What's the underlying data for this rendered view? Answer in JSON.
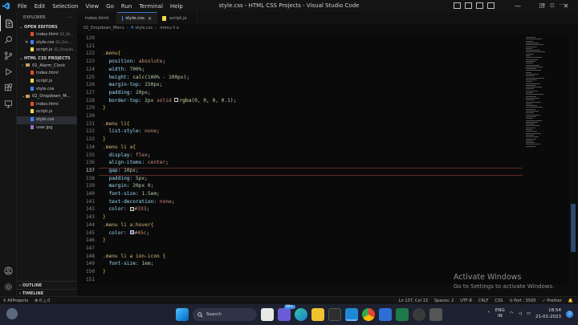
{
  "titlebar": {
    "title": "style.css - HTML CSS Projects - Visual Studio Code",
    "menus": [
      "File",
      "Edit",
      "Selection",
      "View",
      "Go",
      "Run",
      "Terminal",
      "Help"
    ],
    "controls": {
      "minimize": "—",
      "maximize": "☐",
      "close": "✕"
    }
  },
  "sidebar": {
    "header": "EXPLORER",
    "header_more": "···",
    "open_editors_label": "OPEN EDITORS",
    "open_editors": [
      {
        "name": "index.html",
        "desc": "02_Dr...",
        "color": "#e44d26",
        "close": ""
      },
      {
        "name": "style.css",
        "desc": "02_Dro...",
        "color": "#3b82f6",
        "close": "✕"
      },
      {
        "name": "script.js",
        "desc": "02_Dropdo...",
        "color": "#f0db4f",
        "close": ""
      }
    ],
    "project_label": "HTML CSS PROJECTS",
    "tree": [
      {
        "name": "01_Alarm_Clock",
        "type": "folder",
        "depth": 1,
        "arrow": "›",
        "color": "#c5a15a"
      },
      {
        "name": "index.html",
        "type": "file",
        "depth": 2,
        "color": "#e44d26"
      },
      {
        "name": "script.js",
        "type": "file",
        "depth": 2,
        "color": "#f0db4f"
      },
      {
        "name": "style.css",
        "type": "file",
        "depth": 2,
        "color": "#3b82f6"
      },
      {
        "name": "02_Dropdown_M...",
        "type": "folder",
        "depth": 1,
        "arrow": "⌄",
        "color": "#c5a15a"
      },
      {
        "name": "index.html",
        "type": "file",
        "depth": 2,
        "color": "#e44d26"
      },
      {
        "name": "script.js",
        "type": "file",
        "depth": 2,
        "color": "#f0db4f"
      },
      {
        "name": "style.css",
        "type": "file",
        "depth": 2,
        "color": "#3b82f6",
        "active": true
      },
      {
        "name": "user.jpg",
        "type": "file",
        "depth": 2,
        "color": "#a66bd3"
      }
    ],
    "outline_label": "OUTLINE",
    "timeline_label": "TIMELINE"
  },
  "tabs": [
    {
      "label": "index.html",
      "color": "#e44d26",
      "active": false,
      "close": ""
    },
    {
      "label": "style.css",
      "color": "#3b82f6",
      "active": true,
      "close": "✕"
    },
    {
      "label": "script.js",
      "color": "#f0db4f",
      "active": false,
      "close": ""
    }
  ],
  "tab_actions": [
    "⇄",
    "◫",
    "···"
  ],
  "breadcrumb": {
    "folder": "02_Dropdown_Menu",
    "file": "style.css",
    "symbol": ".menu li a",
    "sep": "›"
  },
  "editor": {
    "current_line": 137,
    "lines": [
      {
        "n": 120,
        "t": []
      },
      {
        "n": 121,
        "t": []
      },
      {
        "n": 122,
        "t": [
          [
            "sel",
            ".menu"
          ],
          [
            "brace",
            "{"
          ]
        ]
      },
      {
        "n": 123,
        "t": [
          [
            "prop",
            "  position"
          ],
          [
            "",
            ": "
          ],
          [
            "val",
            "absolute"
          ],
          [
            "",
            ";"
          ]
        ]
      },
      {
        "n": 124,
        "t": [
          [
            "prop",
            "  width"
          ],
          [
            "",
            ": "
          ],
          [
            "num",
            "700%"
          ],
          [
            "",
            ";"
          ]
        ]
      },
      {
        "n": 125,
        "t": [
          [
            "prop",
            "  height"
          ],
          [
            "",
            ": "
          ],
          [
            "fn",
            "calc"
          ],
          [
            "",
            "("
          ],
          [
            "num",
            "100%"
          ],
          [
            "",
            " - "
          ],
          [
            "num",
            "100px"
          ],
          [
            "",
            ");"
          ]
        ]
      },
      {
        "n": 126,
        "t": [
          [
            "prop",
            "  margin-top"
          ],
          [
            "",
            ": "
          ],
          [
            "num",
            "150px"
          ],
          [
            "",
            ";"
          ]
        ]
      },
      {
        "n": 127,
        "t": [
          [
            "prop",
            "  padding"
          ],
          [
            "",
            ": "
          ],
          [
            "num",
            "20px"
          ],
          [
            "",
            ";"
          ]
        ]
      },
      {
        "n": 128,
        "t": [
          [
            "prop",
            "  border-top"
          ],
          [
            "",
            ": "
          ],
          [
            "num",
            "2px"
          ],
          [
            "",
            " "
          ],
          [
            "val",
            "solid"
          ],
          [
            "",
            " "
          ],
          [
            "swatch",
            "#000000"
          ],
          [
            "fn",
            "rgba"
          ],
          [
            "",
            "("
          ],
          [
            "num",
            "0"
          ],
          [
            "",
            ", "
          ],
          [
            "num",
            "0"
          ],
          [
            "",
            ", "
          ],
          [
            "num",
            "0"
          ],
          [
            "",
            ", "
          ],
          [
            "num",
            "0.1"
          ],
          [
            "",
            ");"
          ]
        ]
      },
      {
        "n": 129,
        "t": [
          [
            "brace",
            "}"
          ]
        ]
      },
      {
        "n": 130,
        "t": []
      },
      {
        "n": 131,
        "t": [
          [
            "sel",
            ".menu li"
          ],
          [
            "brace",
            "{"
          ]
        ]
      },
      {
        "n": 132,
        "t": [
          [
            "prop",
            "  list-style"
          ],
          [
            "",
            ": "
          ],
          [
            "val",
            "none"
          ],
          [
            "",
            ";"
          ]
        ]
      },
      {
        "n": 133,
        "t": [
          [
            "brace",
            "}"
          ]
        ]
      },
      {
        "n": 134,
        "t": [
          [
            "sel",
            ".menu li a"
          ],
          [
            "brace",
            "{"
          ]
        ]
      },
      {
        "n": 135,
        "t": [
          [
            "prop",
            "  display"
          ],
          [
            "",
            ": "
          ],
          [
            "val",
            "flex"
          ],
          [
            "",
            ";"
          ]
        ]
      },
      {
        "n": 136,
        "t": [
          [
            "prop",
            "  align-items"
          ],
          [
            "",
            ": "
          ],
          [
            "val",
            "center"
          ],
          [
            "",
            ";"
          ]
        ]
      },
      {
        "n": 137,
        "t": [
          [
            "prop",
            "  gap"
          ],
          [
            "",
            ": "
          ],
          [
            "num",
            "10px"
          ],
          [
            "",
            ";"
          ]
        ]
      },
      {
        "n": 138,
        "t": [
          [
            "prop",
            "  padding"
          ],
          [
            "",
            ": "
          ],
          [
            "num",
            "5px"
          ],
          [
            "",
            ";"
          ]
        ]
      },
      {
        "n": 139,
        "t": [
          [
            "prop",
            "  margin"
          ],
          [
            "",
            ": "
          ],
          [
            "num",
            "20px"
          ],
          [
            "",
            " "
          ],
          [
            "num",
            "0"
          ],
          [
            "",
            ";"
          ]
        ]
      },
      {
        "n": 140,
        "t": [
          [
            "prop",
            "  font-size"
          ],
          [
            "",
            ": "
          ],
          [
            "num",
            "1.5em"
          ],
          [
            "",
            ";"
          ]
        ]
      },
      {
        "n": 141,
        "t": [
          [
            "prop",
            "  text-decoration"
          ],
          [
            "",
            ": "
          ],
          [
            "val",
            "none"
          ],
          [
            "",
            ";"
          ]
        ]
      },
      {
        "n": 142,
        "t": [
          [
            "prop",
            "  color"
          ],
          [
            "",
            ": "
          ],
          [
            "swatch",
            "#333333"
          ],
          [
            "val",
            "#333"
          ],
          [
            "",
            ";"
          ]
        ]
      },
      {
        "n": 143,
        "t": [
          [
            "brace",
            "}"
          ]
        ]
      },
      {
        "n": 144,
        "t": [
          [
            "sel",
            ".menu li a:hover"
          ],
          [
            "brace",
            "{"
          ]
        ]
      },
      {
        "n": 145,
        "t": [
          [
            "prop",
            "  color"
          ],
          [
            "",
            ": "
          ],
          [
            "swatch",
            "#4455cc"
          ],
          [
            "val",
            "#45c"
          ],
          [
            "",
            ";"
          ]
        ]
      },
      {
        "n": 146,
        "t": [
          [
            "brace",
            "}"
          ]
        ]
      },
      {
        "n": 147,
        "t": []
      },
      {
        "n": 148,
        "t": [
          [
            "sel",
            ".menu li a ion-icon"
          ],
          [
            "",
            " "
          ],
          [
            "brace",
            "{"
          ]
        ]
      },
      {
        "n": 149,
        "t": [
          [
            "prop",
            "  font-size"
          ],
          [
            "",
            ": "
          ],
          [
            "num",
            "1em"
          ],
          [
            "",
            ";"
          ]
        ]
      },
      {
        "n": 150,
        "t": [
          [
            "brace",
            "}"
          ]
        ]
      },
      {
        "n": 151,
        "t": []
      }
    ]
  },
  "watermark": {
    "title": "Activate Windows",
    "subtitle": "Go to Settings to activate Windows."
  },
  "statusbar": {
    "left": [
      "⚲ AllProjects",
      "⊗ 0 △ 0"
    ],
    "right": [
      "Ln 137, Col 13",
      "Spaces: 2",
      "UTF-8",
      "CRLF",
      "CSS",
      "⊙ Port : 5500",
      "✓ Prettier",
      "🔔"
    ]
  },
  "taskbar": {
    "search_label": "Search",
    "tray_lang_1": "ENG",
    "tray_lang_2": "IN",
    "time": "18:54",
    "date": "21-01-2023",
    "badge": "2",
    "notify_badge": "99+"
  }
}
